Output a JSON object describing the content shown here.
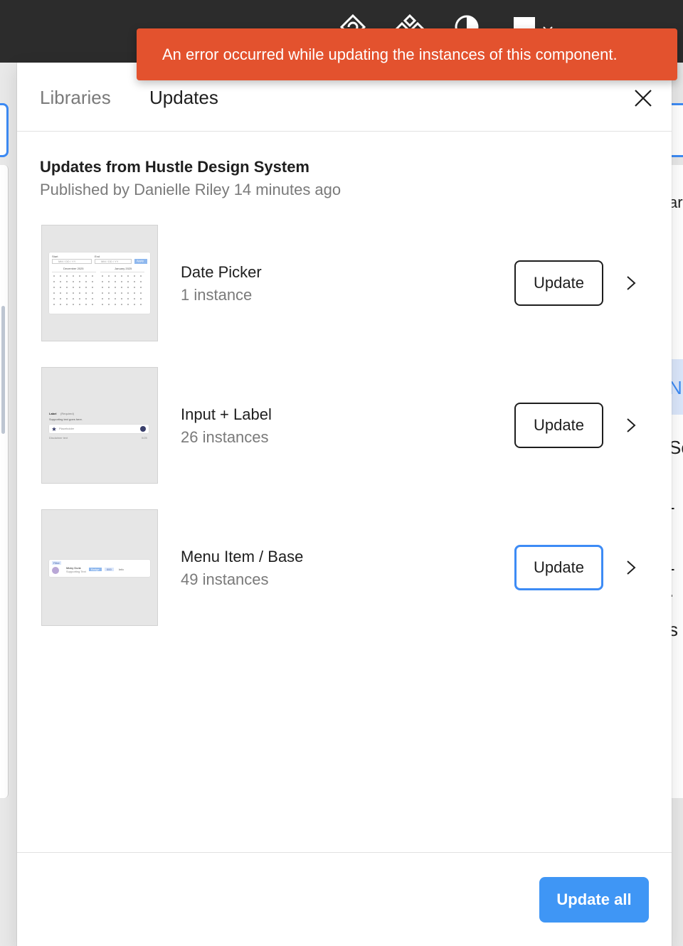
{
  "toast": {
    "message": "An error occurred while updating the instances of this component."
  },
  "modal": {
    "tabs": [
      {
        "label": "Libraries",
        "active": false
      },
      {
        "label": "Updates",
        "active": true
      }
    ],
    "close_icon": "close-icon"
  },
  "updates": {
    "title": "Updates from Hustle Design System",
    "subtitle": "Published by Danielle Riley 14 minutes ago",
    "items": [
      {
        "name": "Date Picker",
        "count": "1 instance",
        "button_label": "Update"
      },
      {
        "name": "Input + Label",
        "count": "26 instances",
        "button_label": "Update"
      },
      {
        "name": "Menu Item / Base",
        "count": "49 instances",
        "button_label": "Update"
      }
    ]
  },
  "thumbs": {
    "date_picker": {
      "start_label": "Start",
      "end_label": "End",
      "input_placeholder": "MM / DD / YY",
      "apply_label": "Apply",
      "month_left": "December 2025",
      "month_right": "January 2025"
    },
    "input_label": {
      "label": "Label",
      "required": "(Required)",
      "supporting": "Supporting text goes here.",
      "placeholder": "Placeholder",
      "disclaimer": "Disclaimer text",
      "counter": "0/25"
    },
    "menu_item": {
      "tag": "Filter",
      "name": "Micky Dunk",
      "supporting": "Supporting Text",
      "chip_a": "Badge",
      "chip_b": "000",
      "chip_c": "Info"
    }
  },
  "footer": {
    "update_all_label": "Update all"
  },
  "background": {
    "fragments": [
      "ar",
      "N",
      "Sc",
      "-",
      "- .",
      "s"
    ]
  },
  "colors": {
    "toast_bg": "#e3522e",
    "accent": "#3f96f5",
    "focus_ring": "#3d8bf5",
    "topbar": "#2c2c2c"
  }
}
